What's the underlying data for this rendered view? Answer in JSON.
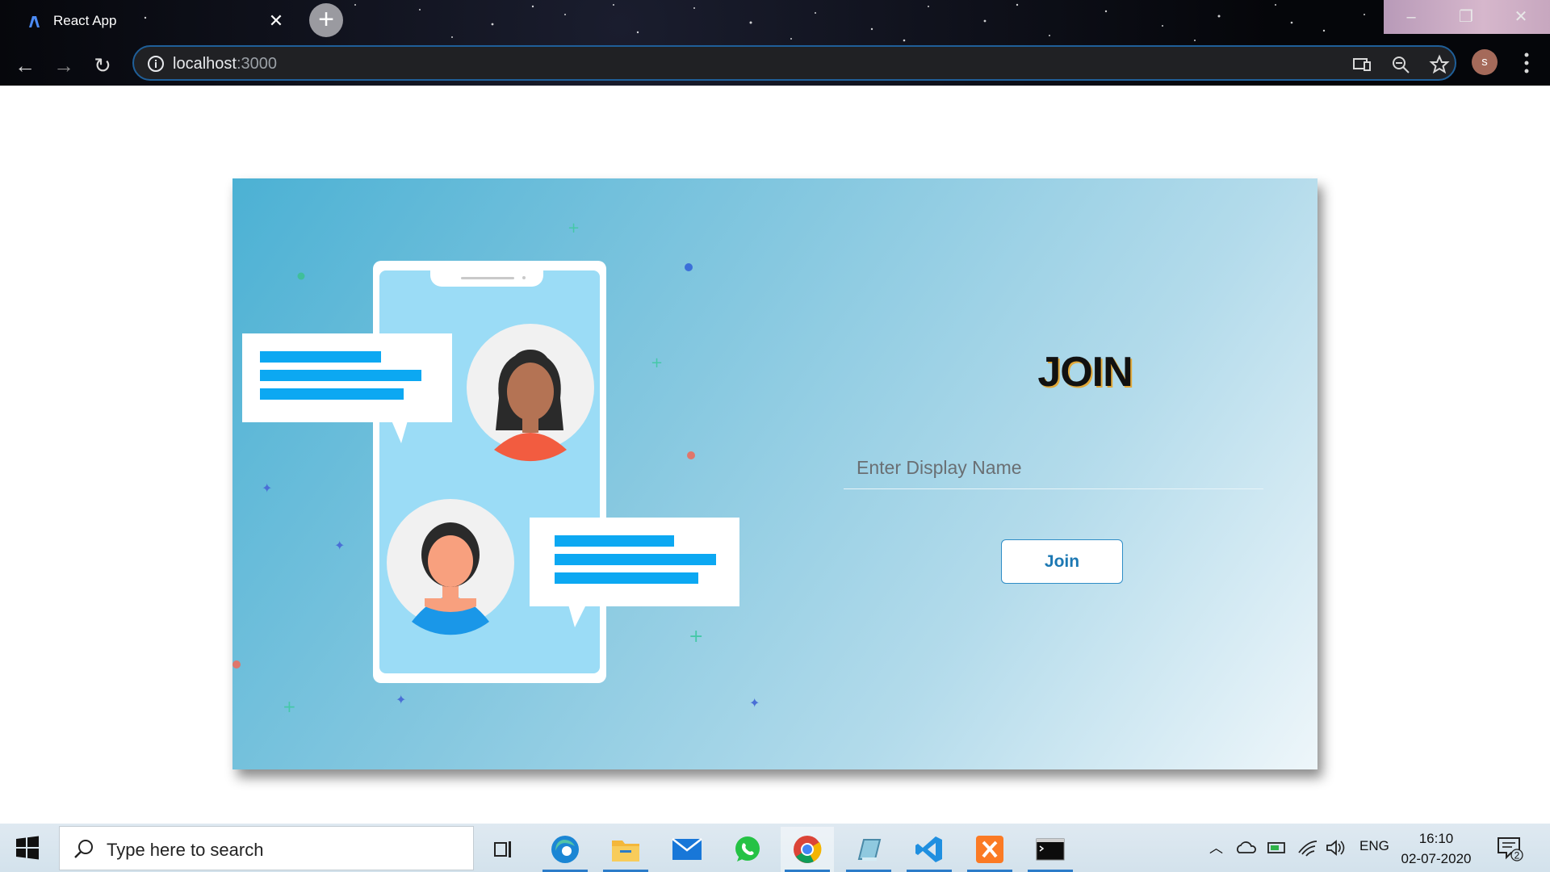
{
  "browser": {
    "tab_title": "React App",
    "url_host": "localhost",
    "url_port": ":3000",
    "profile_initial": "s"
  },
  "page": {
    "title": "JOIN",
    "input_placeholder": "Enter Display Name",
    "input_value": "",
    "join_button_label": "Join",
    "colors": {
      "card_gradient_start": "#4cb1d4",
      "card_gradient_end": "#eef6fa",
      "button_text": "#1c78b3",
      "title_shadow": "#e2a93a"
    }
  },
  "taskbar": {
    "search_placeholder": "Type here to search",
    "apps": [
      "task-view",
      "edge",
      "file-explorer",
      "mail",
      "whatsapp",
      "chrome",
      "notes",
      "vscode",
      "xampp",
      "terminal"
    ],
    "language": "ENG",
    "time": "16:10",
    "date": "02-07-2020",
    "notification_count": "2"
  }
}
